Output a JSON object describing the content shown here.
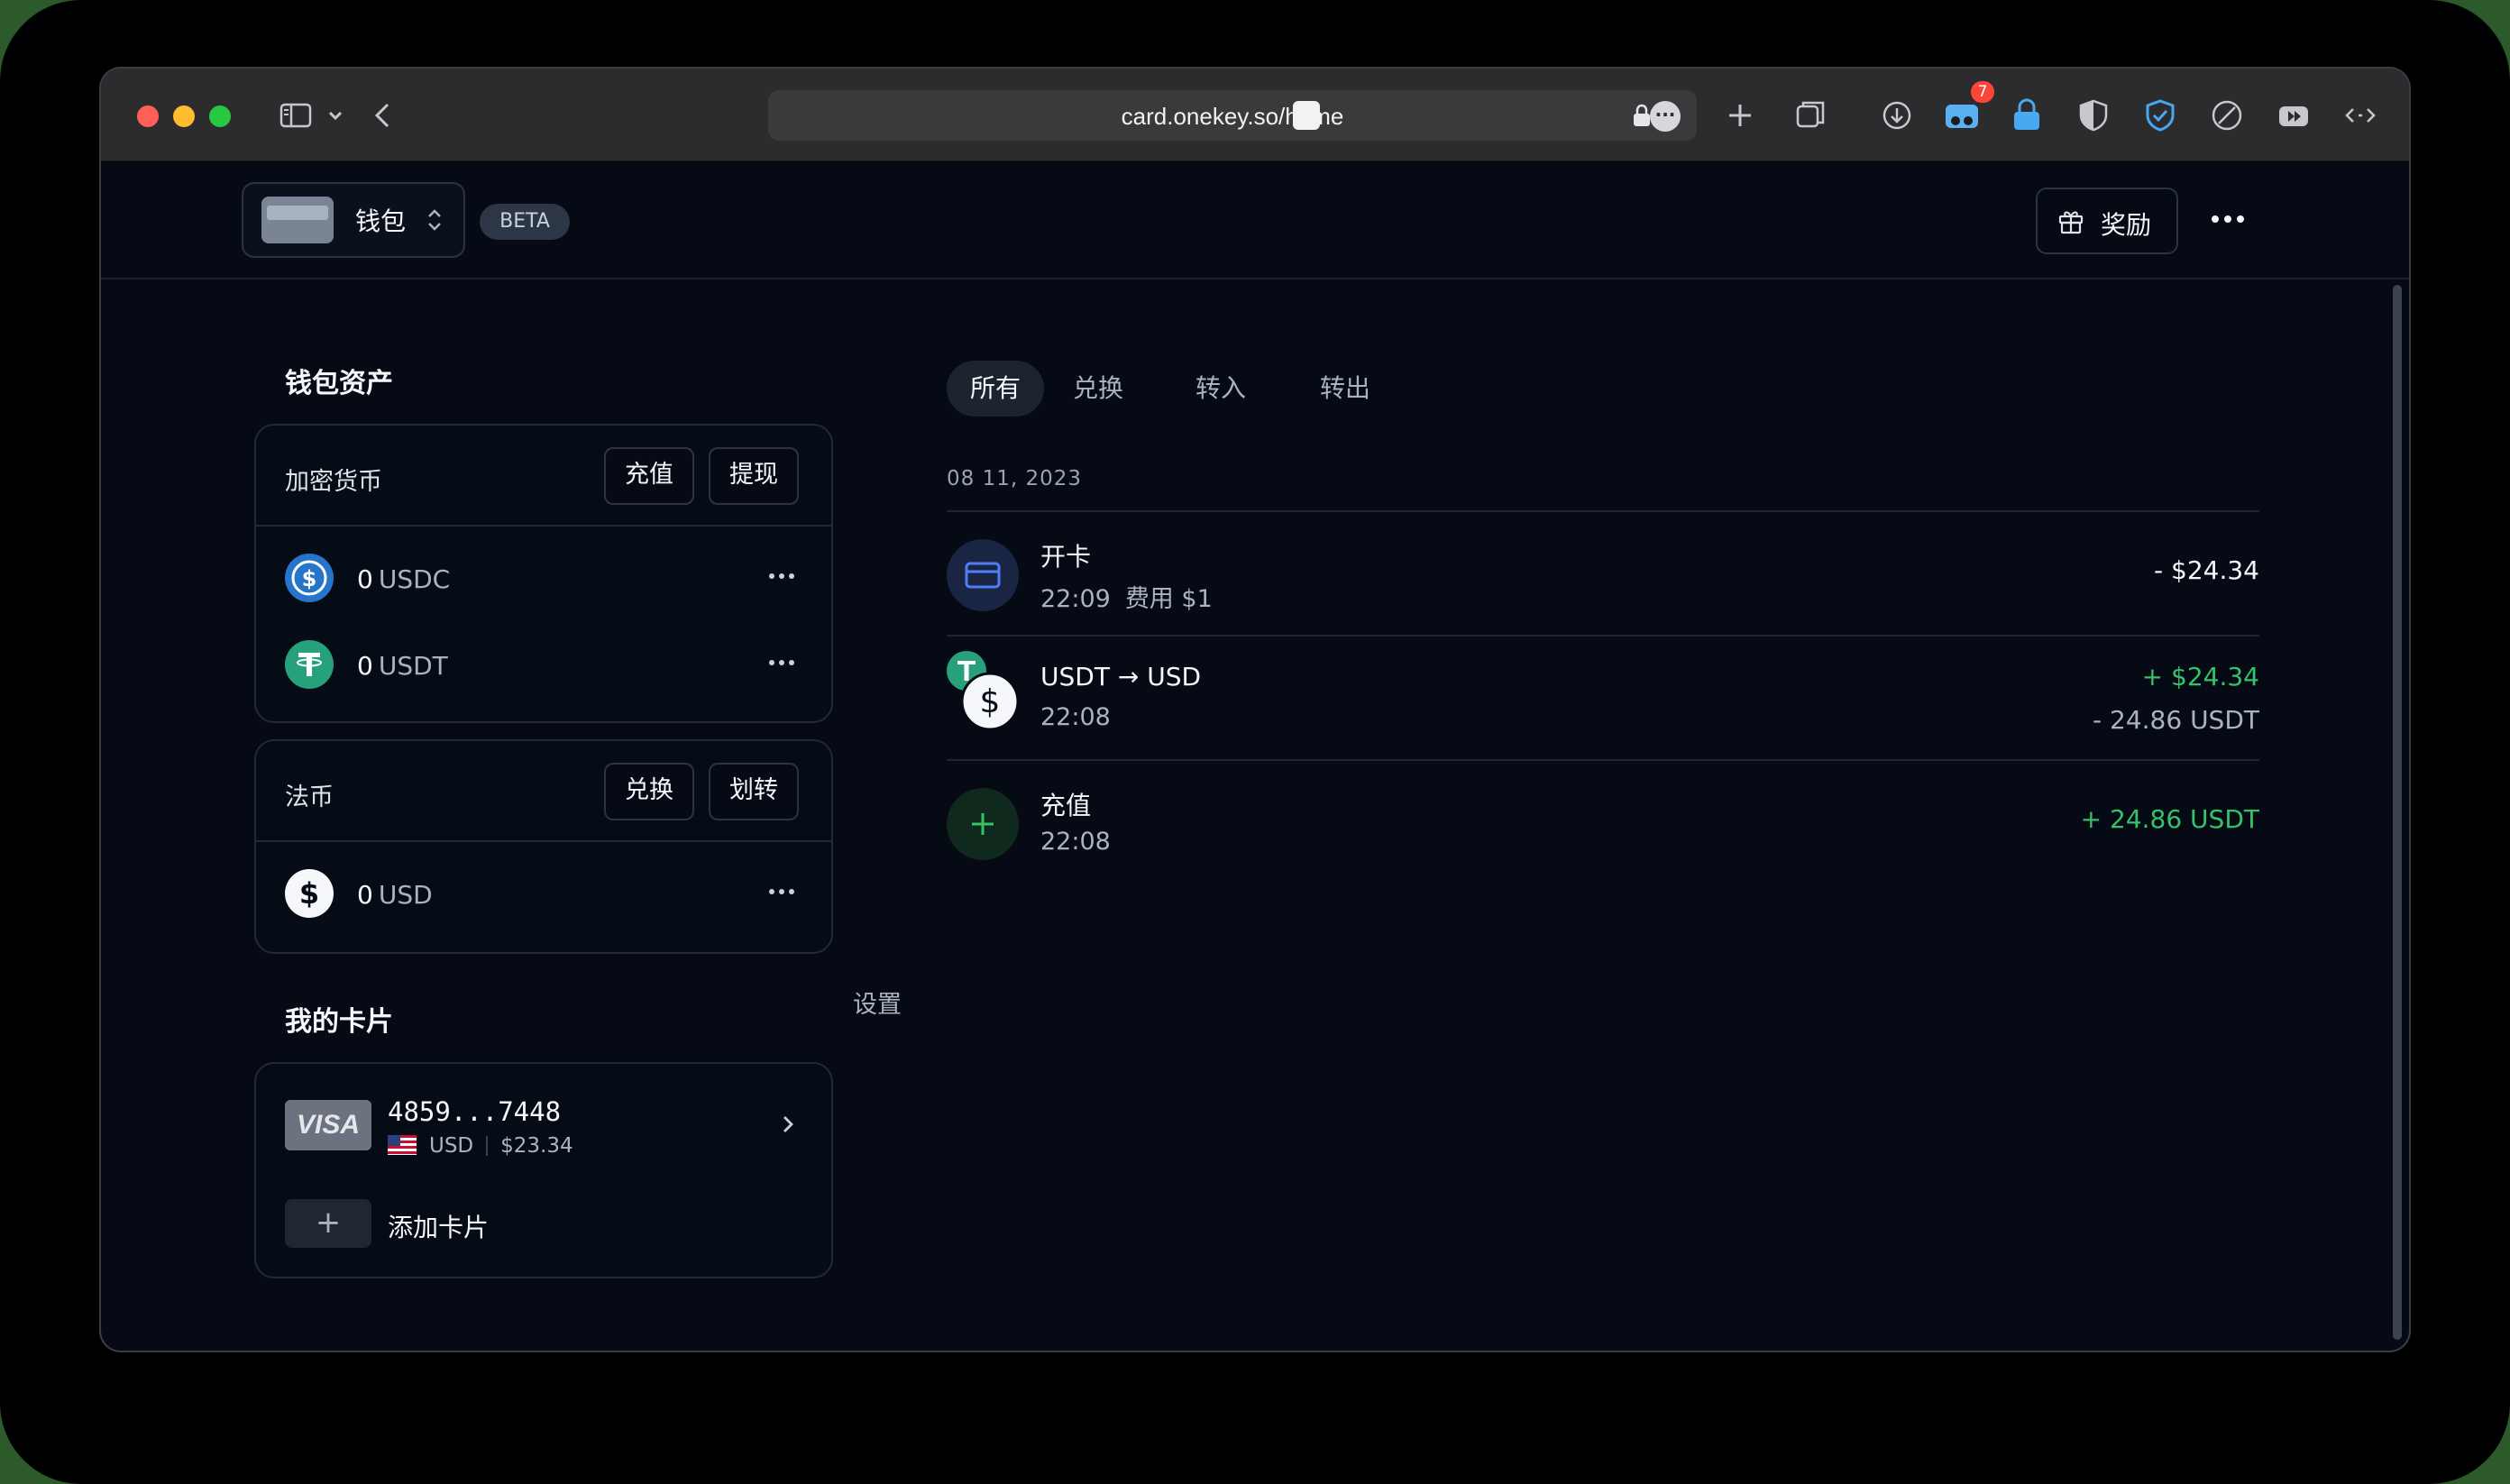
{
  "browser": {
    "url": "card.onekey.so/home",
    "extension_badge": "7"
  },
  "header": {
    "wallet_name": "钱包",
    "beta_label": "BETA",
    "rewards_label": "奖励"
  },
  "assets": {
    "title": "钱包资产",
    "crypto": {
      "label": "加密货币",
      "deposit_label": "充值",
      "withdraw_label": "提现",
      "items": [
        {
          "amount": "0",
          "unit": "USDC",
          "icon": "usdc-icon"
        },
        {
          "amount": "0",
          "unit": "USDT",
          "icon": "usdt-icon"
        }
      ]
    },
    "fiat": {
      "label": "法币",
      "exchange_label": "兑换",
      "transfer_label": "划转",
      "items": [
        {
          "amount": "0",
          "unit": "USD",
          "icon": "usd-icon"
        }
      ]
    }
  },
  "cards": {
    "title": "我的卡片",
    "settings_label": "设置",
    "items": [
      {
        "brand": "VISA",
        "number": "4859...7448",
        "currency": "USD",
        "balance": "$23.34"
      }
    ],
    "add_label": "添加卡片"
  },
  "activity": {
    "tabs": [
      "所有",
      "兑换",
      "转入",
      "转出"
    ],
    "active_tab": "所有",
    "date": "08 11, 2023",
    "transactions": [
      {
        "title": "开卡",
        "time": "22:09",
        "fee": "费用 $1",
        "amount": "- $24.34"
      },
      {
        "title_from": "USDT",
        "title_to": "USD",
        "time": "22:08",
        "amount": "+ $24.34",
        "amount_secondary": "- 24.86 USDT"
      },
      {
        "title": "充值",
        "time": "22:08",
        "amount": "+ 24.86 USDT"
      }
    ]
  },
  "colors": {
    "background": "#050a14",
    "positive": "#34c26a",
    "usdc": "#2775ca",
    "usdt": "#26a17b"
  }
}
